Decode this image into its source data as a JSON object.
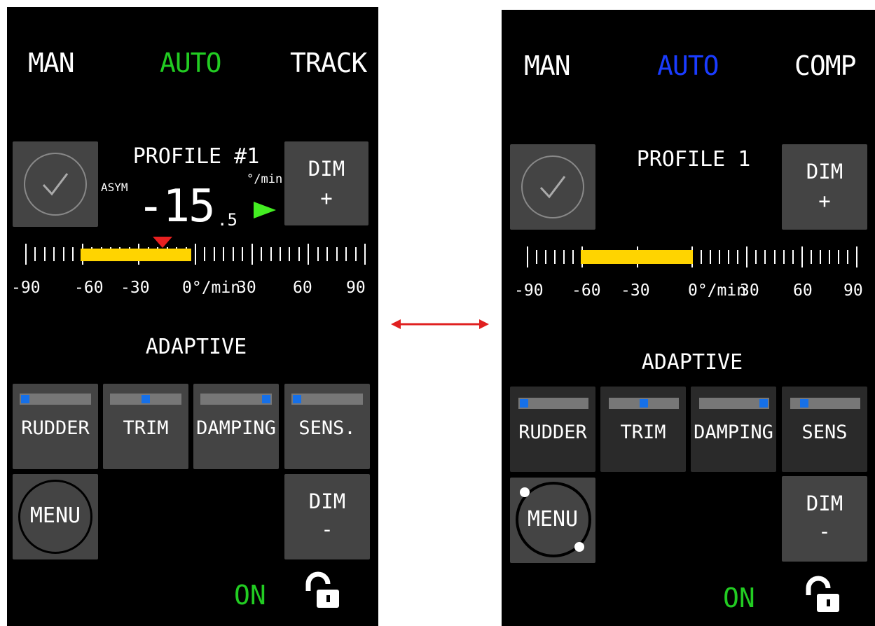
{
  "left": {
    "modes": {
      "man": "MAN",
      "auto": "AUTO",
      "track": "TRACK"
    },
    "auto_color": "#22cc22",
    "profile": "PROFILE #1",
    "asym": "ASYM",
    "unit_top": "°/min",
    "value_main": "-15",
    "value_decimal": ".5",
    "dim_plus": {
      "line1": "DIM",
      "line2": "+"
    },
    "scale": [
      "-90",
      "-60",
      "-30",
      "0°/min",
      "30",
      "60",
      "90"
    ],
    "rate_bar_range": [
      -60,
      0
    ],
    "marker_value": -15,
    "adaptive": "ADAPTIVE",
    "controls": [
      {
        "label": "RUDDER",
        "level": 0.0
      },
      {
        "label": "TRIM",
        "level": 0.5
      },
      {
        "label": "DAMPING",
        "level": 1.0
      },
      {
        "label": "SENS.",
        "level": 0.0
      }
    ],
    "menu": "MENU",
    "dim_minus": {
      "line1": "DIM",
      "line2": "-"
    },
    "status": "ON",
    "lock_icon": "unlocked-padlock-icon"
  },
  "right": {
    "modes": {
      "man": "MAN",
      "auto": "AUTO",
      "comp": "COMP"
    },
    "auto_color": "#1a3cff",
    "profile": "PROFILE 1",
    "dim_plus": {
      "line1": "DIM",
      "line2": "+"
    },
    "scale": [
      "-90",
      "-60",
      "-30",
      "0°/min",
      "30",
      "60",
      "90"
    ],
    "rate_bar_range": [
      -60,
      0
    ],
    "adaptive": "ADAPTIVE",
    "controls": [
      {
        "label": "RUDDER",
        "level": 0.0
      },
      {
        "label": "TRIM",
        "level": 0.5
      },
      {
        "label": "DAMPING",
        "level": 1.0
      },
      {
        "label": "SENS",
        "level": 0.0
      }
    ],
    "menu": "MENU",
    "dim_minus": {
      "line1": "DIM",
      "line2": "-"
    },
    "status": "ON",
    "lock_icon": "unlocked-padlock-icon"
  },
  "comparison_arrow_icon": "double-headed-arrow-icon",
  "colors": {
    "bar": "#ffd400",
    "knob": "#1670e8",
    "on": "#22cc22",
    "marker": "#e82020",
    "arrow": "#e02020"
  }
}
